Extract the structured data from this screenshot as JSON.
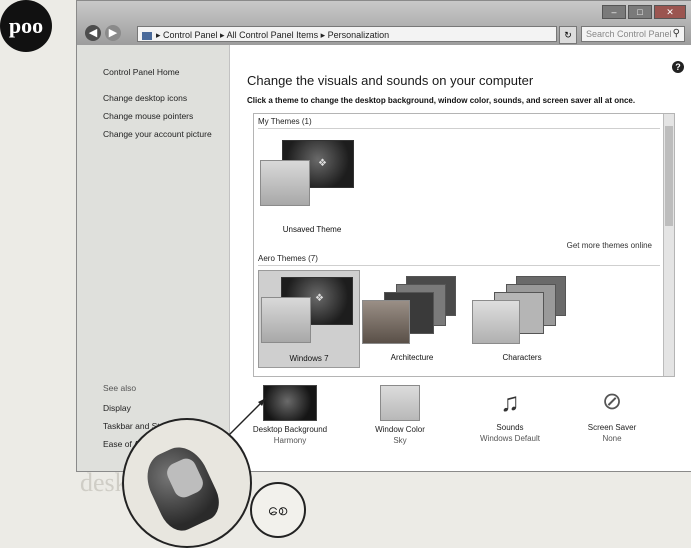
{
  "page_badge": "poo",
  "window": {
    "address_bar": {
      "path": "▸  Control Panel  ▸  All Control Panel Items  ▸  Personalization",
      "search_placeholder": "Search Control Panel"
    }
  },
  "sidebar": {
    "home": "Control Panel Home",
    "links": [
      "Change desktop icons",
      "Change mouse pointers",
      "Change your account picture"
    ],
    "see_also_title": "See also",
    "see_also": [
      "Display",
      "Taskbar and Start Menu",
      "Ease of Access Center"
    ]
  },
  "main": {
    "title": "Change the visuals and sounds on your computer",
    "subtitle": "Click a theme to change the desktop background, window color, sounds, and screen saver all at once.",
    "my_themes_label": "My Themes (1)",
    "unsaved_theme": "Unsaved Theme",
    "get_more": "Get more themes online",
    "aero_themes_label": "Aero Themes (7)",
    "aero_themes": [
      "Windows 7",
      "Architecture",
      "Characters"
    ]
  },
  "bottom_bar": [
    {
      "title": "Desktop Background",
      "value": "Harmony",
      "icon": "desktop-background-icon"
    },
    {
      "title": "Window Color",
      "value": "Sky",
      "icon": "window-color-icon"
    },
    {
      "title": "Sounds",
      "value": "Windows Default",
      "icon": "sounds-icon"
    },
    {
      "title": "Screen Saver",
      "value": "None",
      "icon": "screen-saver-icon"
    }
  ],
  "lang_mark": "စေ"
}
